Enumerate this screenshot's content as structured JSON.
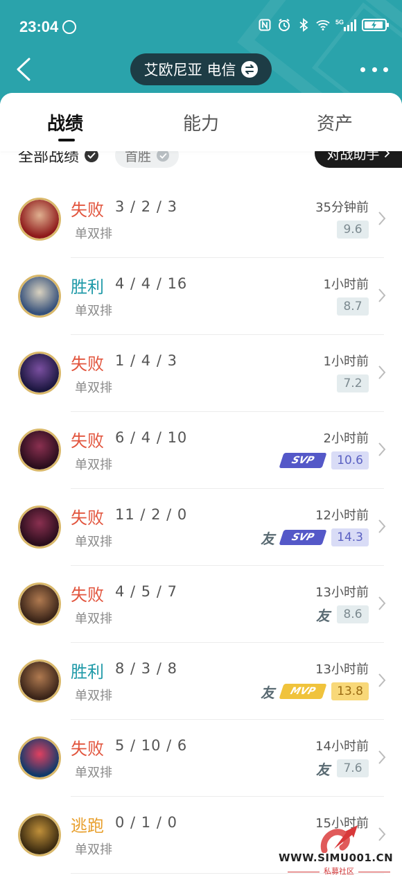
{
  "status_bar": {
    "time": "23:04",
    "icons": [
      "hand-icon",
      "nfc-icon",
      "alarm-icon",
      "bluetooth-icon",
      "wifi-icon",
      "5g-signal-icon",
      "battery-charging-icon"
    ],
    "network": "5G"
  },
  "nav": {
    "back_icon": "chevron-left-icon",
    "server": "艾欧尼亚 电信",
    "swap_icon": "swap-icon",
    "more_icon": "more-dots-icon"
  },
  "tabs": [
    {
      "label": "战绩",
      "active": true
    },
    {
      "label": "能力",
      "active": false
    },
    {
      "label": "资产",
      "active": false
    }
  ],
  "filters": {
    "all_label": "全部战绩",
    "chip_label": "首胜",
    "assist_label": "对战助手"
  },
  "colors": {
    "header_bg": "#2aa3ab",
    "server_pill_bg": "#1d3c45",
    "loss": "#e2563f",
    "win": "#1f9aa8",
    "escape": "#e8a02e",
    "svp": "#5458c8",
    "mvp": "#f0c33c"
  },
  "matches": [
    {
      "result": "失败",
      "result_type": "loss",
      "kda": "3 / 2 / 3",
      "mode": "单双排",
      "time": "35分钟前",
      "score": "9.6",
      "score_type": "normal",
      "you": false,
      "tag": "",
      "avatar_colors": [
        "#8e1a1a",
        "#e0b090"
      ]
    },
    {
      "result": "胜利",
      "result_type": "win",
      "kda": "4 / 4 / 16",
      "mode": "单双排",
      "time": "1小时前",
      "score": "8.7",
      "score_type": "normal",
      "you": false,
      "tag": "",
      "avatar_colors": [
        "#35507a",
        "#d9d2c0"
      ]
    },
    {
      "result": "失败",
      "result_type": "loss",
      "kda": "1 / 4 / 3",
      "mode": "单双排",
      "time": "1小时前",
      "score": "7.2",
      "score_type": "normal",
      "you": false,
      "tag": "",
      "avatar_colors": [
        "#1c1740",
        "#7a4fa0"
      ]
    },
    {
      "result": "失败",
      "result_type": "loss",
      "kda": "6 / 4 / 10",
      "mode": "单双排",
      "time": "2小时前",
      "score": "10.6",
      "score_type": "svp",
      "you": false,
      "tag": "SVP",
      "avatar_colors": [
        "#2a0d1c",
        "#8a3050"
      ]
    },
    {
      "result": "失败",
      "result_type": "loss",
      "kda": "11 / 2 / 0",
      "mode": "单双排",
      "time": "12小时前",
      "score": "14.3",
      "score_type": "svp",
      "you": true,
      "tag": "SVP",
      "avatar_colors": [
        "#2a0d1c",
        "#8a3050"
      ]
    },
    {
      "result": "失败",
      "result_type": "loss",
      "kda": "4 / 5 / 7",
      "mode": "单双排",
      "time": "13小时前",
      "score": "8.6",
      "score_type": "normal",
      "you": true,
      "tag": "",
      "avatar_colors": [
        "#3a2418",
        "#b07a50"
      ]
    },
    {
      "result": "胜利",
      "result_type": "win",
      "kda": "8 / 3 / 8",
      "mode": "单双排",
      "time": "13小时前",
      "score": "13.8",
      "score_type": "mvp",
      "you": true,
      "tag": "MVP",
      "avatar_colors": [
        "#3a2418",
        "#b07a50"
      ]
    },
    {
      "result": "失败",
      "result_type": "loss",
      "kda": "5 / 10 / 6",
      "mode": "单双排",
      "time": "14小时前",
      "score": "7.6",
      "score_type": "normal",
      "you": true,
      "tag": "",
      "avatar_colors": [
        "#103a6a",
        "#e04060"
      ]
    },
    {
      "result": "逃跑",
      "result_type": "escape",
      "kda": "0 / 1 / 0",
      "mode": "单双排",
      "time": "15小时前",
      "score": "",
      "score_type": "normal",
      "you": false,
      "tag": "",
      "avatar_colors": [
        "#3a2a10",
        "#c0903a"
      ]
    }
  ],
  "you_label": "友",
  "watermark": {
    "url": "WWW.SIMU001.CN",
    "sub": "私募社区"
  }
}
